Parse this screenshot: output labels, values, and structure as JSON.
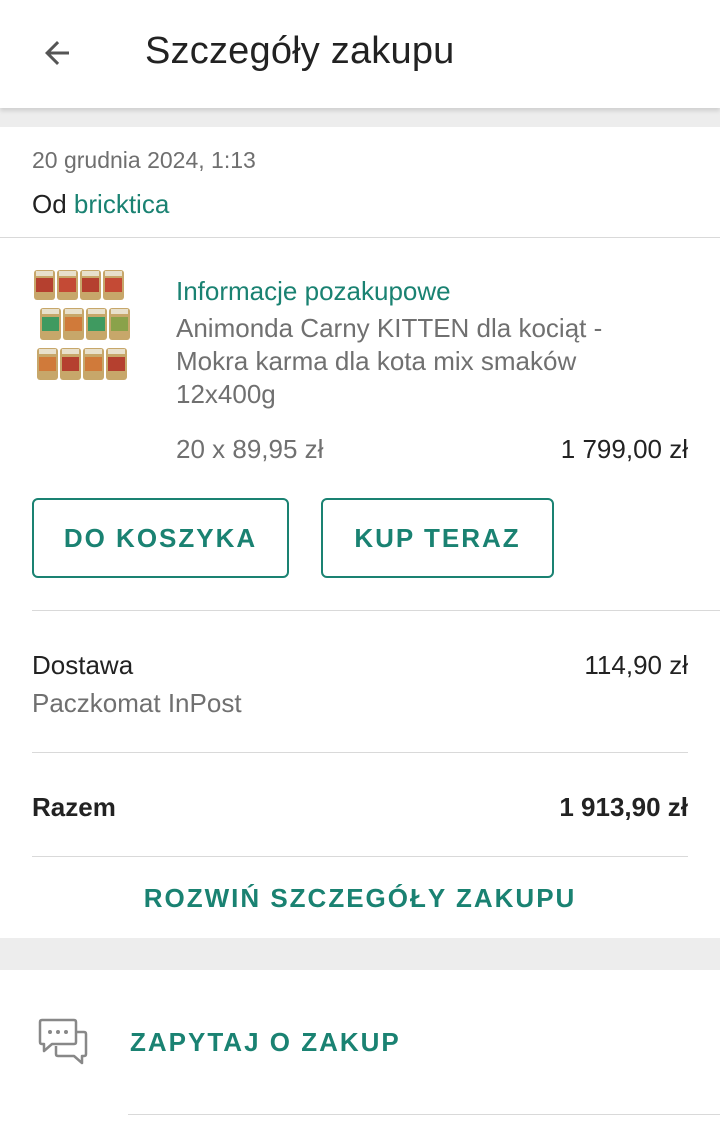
{
  "header": {
    "title": "Szczegóły zakupu",
    "back_icon": "arrow-left-icon"
  },
  "purchase": {
    "date": "20 grudnia 2024, 1:13",
    "seller_prefix": "Od",
    "seller_name": "bricktica"
  },
  "item": {
    "info_link": "Informacje pozakupowe",
    "title": "Animonda Carny KITTEN dla kociąt - Mokra karma dla kota mix smaków 12x400g",
    "quantity_price": "20 x 89,95 zł",
    "total": "1 799,00 zł",
    "thumbnail": "product-cans-image"
  },
  "actions": {
    "add_to_cart": "DO KOSZYKA",
    "buy_now": "KUP TERAZ"
  },
  "delivery": {
    "label": "Dostawa",
    "method": "Paczkomat InPost",
    "price": "114,90 zł"
  },
  "summary": {
    "label": "Razem",
    "total": "1 913,90 zł"
  },
  "expand_details": "ROZWIŃ SZCZEGÓŁY ZAKUPU",
  "ask": {
    "label": "ZAPYTAJ O ZAKUP",
    "icon": "chat-bubbles-icon"
  },
  "colors": {
    "accent": "#1a8272",
    "text_primary": "#222222",
    "text_secondary": "#707070",
    "background_gap": "#ededed"
  }
}
